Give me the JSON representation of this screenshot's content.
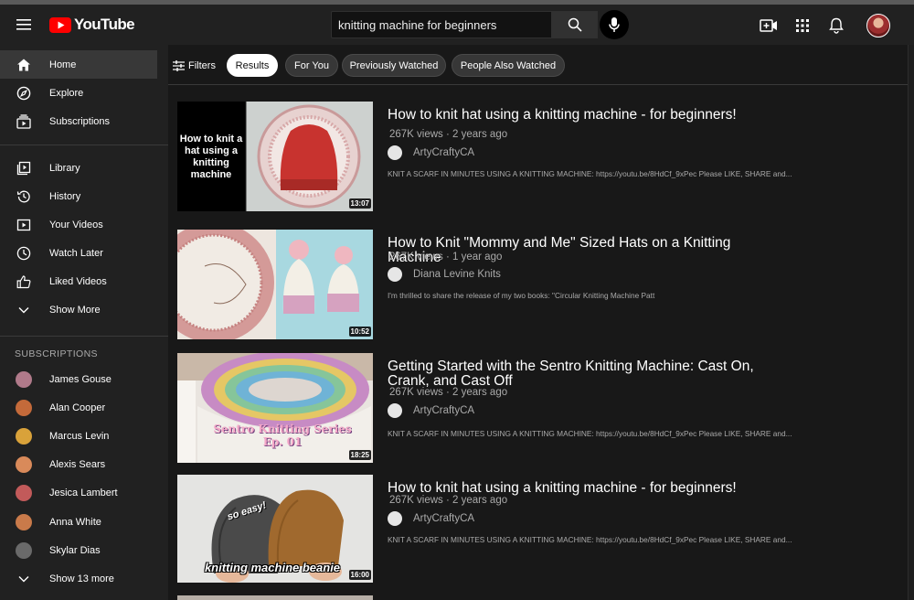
{
  "header": {
    "logo_text": "YouTube",
    "search_value": "knitting machine for beginners",
    "search_placeholder": "Search"
  },
  "sidebar": {
    "main_items": [
      {
        "label": "Home",
        "icon": "home-icon",
        "active": true
      },
      {
        "label": "Explore",
        "icon": "compass-icon"
      },
      {
        "label": "Subscriptions",
        "icon": "subscriptions-icon"
      }
    ],
    "library_items": [
      {
        "label": "Library",
        "icon": "library-icon"
      },
      {
        "label": "History",
        "icon": "history-icon"
      },
      {
        "label": "Your Videos",
        "icon": "your-videos-icon"
      },
      {
        "label": "Watch Later",
        "icon": "clock-icon"
      },
      {
        "label": "Liked Videos",
        "icon": "thumbs-up-icon"
      },
      {
        "label": "Show More",
        "icon": "chevron-down-icon"
      }
    ],
    "subscriptions_heading": "SUBSCRIPTIONS",
    "subscriptions": [
      {
        "name": "James Gouse",
        "color": "#b07a8a"
      },
      {
        "name": "Alan Cooper",
        "color": "#c46a3a"
      },
      {
        "name": "Marcus Levin",
        "color": "#d9a23a"
      },
      {
        "name": "Alexis Sears",
        "color": "#d98a5a"
      },
      {
        "name": "Jesica Lambert",
        "color": "#c25a5a"
      },
      {
        "name": "Anna White",
        "color": "#c97a4a"
      },
      {
        "name": "Skylar Dias",
        "color": "#6a6a6a"
      }
    ],
    "show_more_subs": "Show 13 more"
  },
  "filters": {
    "filters_label": "Filters",
    "chips": [
      {
        "label": "Results",
        "active": true
      },
      {
        "label": "For You"
      },
      {
        "label": "Previously Watched"
      },
      {
        "label": "People Also Watched"
      }
    ]
  },
  "results": [
    {
      "title": "How to knit hat using a knitting machine - for beginners!",
      "meta": "267K views · 2 years ago",
      "channel": "ArtyCraftyCA",
      "description": "KNIT A SCARF IN MINUTES USING A KNITTING MACHINE: https://youtu.be/8HdCf_9xPec Please LIKE, SHARE and...",
      "duration": "13:07",
      "thumb_text": "How to knit a hat using a knitting machine"
    },
    {
      "title": "How to Knit \"Mommy and Me\" Sized Hats on a Knitting Machine",
      "meta": "267K views · 1 year ago",
      "channel": "Diana Levine Knits",
      "description": "I'm thrilled to share the release of my two books: \"Circular Knitting Machine Patt",
      "duration": "10:52"
    },
    {
      "title": "Getting Started with the Sentro Knitting Machine: Cast On, Crank, and Cast Off",
      "meta": "267K views · 2 years ago",
      "channel": "ArtyCraftyCA",
      "description": "KNIT A SCARF IN MINUTES USING A KNITTING MACHINE: https://youtu.be/8HdCf_9xPec Please LIKE, SHARE and...",
      "duration": "18:25",
      "thumb_text": "Sentro Knitting Series Ep. 01"
    },
    {
      "title": "How to knit hat using a knitting machine - for beginners!",
      "meta": "267K views · 2 years ago",
      "channel": "ArtyCraftyCA",
      "description": "KNIT A SCARF IN MINUTES USING A KNITTING MACHINE: https://youtu.be/8HdCf_9xPec Please LIKE, SHARE and...",
      "duration": "16:00",
      "thumb_text": "knitting machine beanie",
      "thumb_text_2": "so easy!"
    }
  ]
}
